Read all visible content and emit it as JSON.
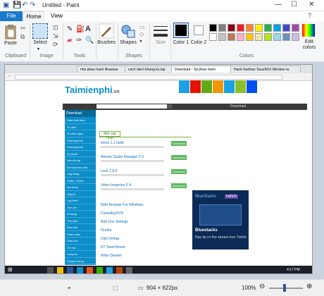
{
  "window": {
    "title": "Untitled - Paint"
  },
  "tabs": {
    "file": "File",
    "home": "Home",
    "view": "View"
  },
  "ribbon": {
    "clipboard": {
      "paste": "Paste",
      "group": "Clipboard"
    },
    "image": {
      "select": "Select",
      "group": "Image"
    },
    "tools": {
      "group": "Tools"
    },
    "brushes": {
      "label": "Brushes"
    },
    "shapes": {
      "label": "Shapes",
      "group": "Shapes"
    },
    "size": {
      "label": "Size"
    },
    "colors": {
      "color1": "Color 1",
      "color2": "Color 2",
      "edit": "Edit colors",
      "group": "Colors"
    },
    "palette": [
      "#000000",
      "#7f7f7f",
      "#880015",
      "#ed1c24",
      "#ff7f27",
      "#fff200",
      "#22b14c",
      "#00a2e8",
      "#3f48cc",
      "#a349a4",
      "#ffffff",
      "#c3c3c3",
      "#b97a57",
      "#ffaec9",
      "#ffc90e",
      "#efe4b0",
      "#b5e61d",
      "#99d9ea",
      "#7092be",
      "#c8bfe7"
    ]
  },
  "screenshot": {
    "browser_tabs": [
      "nha phan hanh ithuanse",
      "cach dat it khong ko lap",
      "Download - Tai phan mem",
      "Hanh Karthan Souz50ol Window vs"
    ],
    "site": {
      "logo": "Taimienphi",
      "logo_suffix": ".vn",
      "nav_right": "Download"
    },
    "sidebar_header": "Download",
    "sidebar_items": [
      "Diem lam hien",
      "Tu dien",
      "Tu dien ngon",
      "Chuong trinh",
      "Chuong trinh",
      "Ky thuat",
      "Van phong",
      "Do hoa hinh anh",
      "Ung dung",
      "Audio - Video",
      "Am nhac",
      "Giai tri",
      "Lap trinh",
      "Tien ich",
      "Di dong",
      "Thu vien",
      "Bao mat",
      "Phan mem",
      "Giao duc",
      "Tin hoc",
      "Cong cu",
      "Chuyen dong"
    ],
    "section_tab": "Moi cap nhat",
    "list_items": [
      {
        "title": "Inbox 1.1 build",
        "btn": "Download"
      },
      {
        "title": "Ahnme Studio Manager 2.0",
        "btn": "Download"
      },
      {
        "title": "Lock Z 8.0",
        "btn": "Download"
      },
      {
        "title": "Video Inspector 2.4",
        "btn": "Download"
      }
    ],
    "ad": {
      "brand1": "BlueStacks",
      "brand2": "twitch",
      "headline": "Bluestacks",
      "sub": "Nay da co the stream tren Twitch"
    },
    "more_links": [
      "Web Browser For Windows",
      "CloneAnyDVD",
      "Add Ons Settings",
      "Firefox",
      "Disk Defrag",
      "KT TeamViewer",
      "Wise Cleaner"
    ],
    "taskbar_time": "4:17 PM"
  },
  "status": {
    "dimensions": "904 × 622px",
    "zoom": "100%"
  }
}
